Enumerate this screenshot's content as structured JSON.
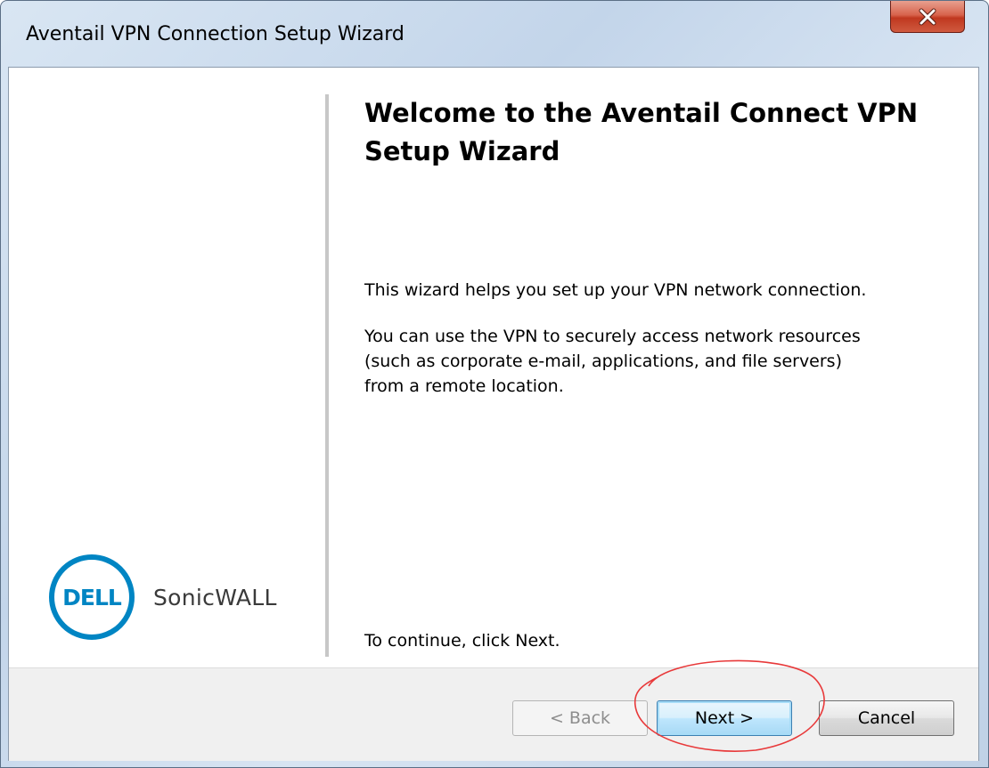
{
  "window": {
    "title": "Aventail VPN Connection Setup Wizard",
    "close_icon": "close-x-icon"
  },
  "wizard": {
    "heading": "Welcome to the Aventail Connect VPN Setup Wizard",
    "intro": "This wizard helps you set up your VPN network connection.",
    "description_lines": [
      "You can use the VPN to securely access network resources",
      "(such as corporate e-mail, applications, and file servers)",
      "from a remote location."
    ],
    "instruction": "To continue, click Next."
  },
  "brand": {
    "logo_text": "DELL",
    "product": "SonicWALL",
    "logo_color": "#0085c3"
  },
  "buttons": {
    "back": "< Back",
    "next": "Next >",
    "cancel": "Cancel"
  },
  "colors": {
    "close_button": "#c7452d",
    "annotation_circle": "#e8393a",
    "next_focus": "#3c7fb1"
  }
}
